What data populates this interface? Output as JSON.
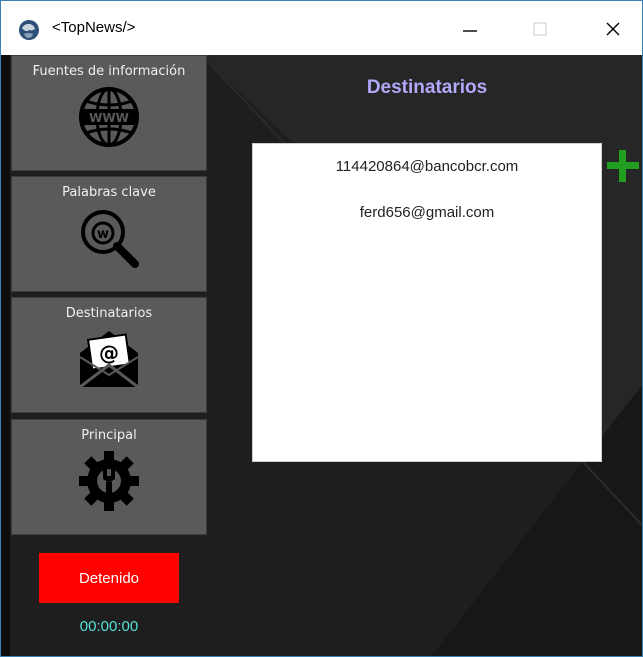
{
  "window": {
    "title": "<TopNews/>",
    "controls": {
      "minimize": "minimize",
      "maximize": "maximize",
      "close": "close"
    }
  },
  "sidebar": {
    "items": [
      {
        "label": "Fuentes de información",
        "icon": "www-globe-icon"
      },
      {
        "label": "Palabras clave",
        "icon": "keyword-search-icon"
      },
      {
        "label": "Destinatarios",
        "icon": "mail-envelope-icon"
      },
      {
        "label": "Principal",
        "icon": "gear-wrench-icon"
      }
    ],
    "status": {
      "label": "Detenido",
      "color": "#ff0000"
    },
    "timer": "00:00:00"
  },
  "main": {
    "title": "Destinatarios",
    "recipients": [
      "114420864@bancobcr.com",
      "ferd656@gmail.com"
    ],
    "add_icon": "plus-icon"
  },
  "colors": {
    "background": "#1e1e1e",
    "nav_button": "#5a5a5a",
    "title_accent": "#b0a8f8",
    "timer": "#55e0d8",
    "add": "#1f9e1f"
  }
}
